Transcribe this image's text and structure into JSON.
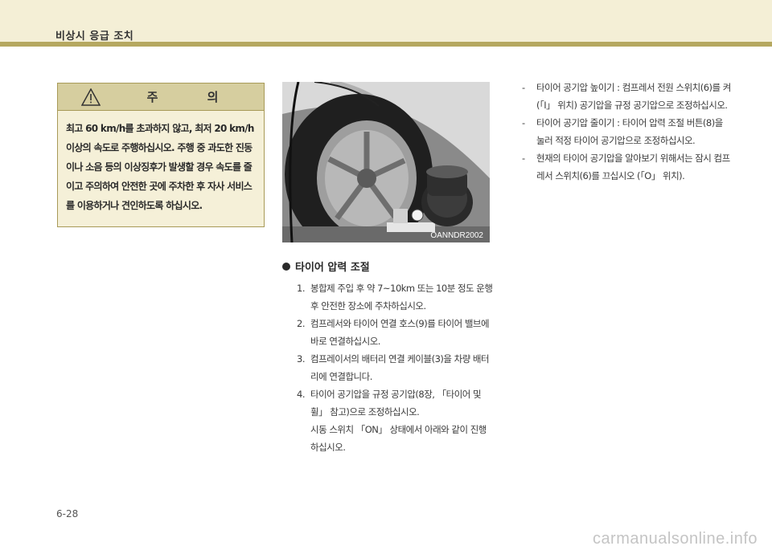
{
  "header": {
    "title": "비상시 응급 조치"
  },
  "caution": {
    "title": "주 의",
    "body": "최고 60 km/h를 초과하지 않고, 최저 20 km/h 이상의 속도로 주행하십시오. 주행 중 과도한 진동이나 소음 등의 이상징후가 발생할 경우 속도를 줄이고 주의하여 안전한 곳에 주차한 후 자사 서비스를 이용하거나 견인하도록 하십시오."
  },
  "photo": {
    "code": "OANNDR2002"
  },
  "section": {
    "title": "타이어 압력 조절",
    "steps": [
      {
        "num": "1.",
        "text": "봉합제 주입 후 약 7~10km 또는 10분 정도 운행 후 안전한 장소에 주차하십시오."
      },
      {
        "num": "2.",
        "text": "컴프레서와 타이어 연결 호스(9)를 타이어 밸브에 바로 연결하십시오."
      },
      {
        "num": "3.",
        "text": "컴프레이서의 배터리 연결 케이블(3)을 차량 배터리에 연결합니다."
      },
      {
        "num": "4.",
        "text": "타이어 공기압을 규정 공기압(8장, 「타이어 및 휠」 참고)으로 조정하십시오.",
        "extra": "시동 스위치 「ON」 상태에서 아래와 같이 진행하십시오."
      }
    ]
  },
  "right_list": [
    {
      "dash": "-",
      "text": "타이어 공기압 높이기 : 컴프레서 전원 스위치(6)를 켜(「I」 위치) 공기압을 규정 공기압으로 조정하십시오."
    },
    {
      "dash": "-",
      "text": "타이어 공기압 줄이기 : 타이어 압력 조절 버튼(8)을 눌러 적정 타이어 공기압으로 조정하십시오."
    },
    {
      "dash": "-",
      "text": "현재의 타이어 공기압을 알아보기 위해서는 잠시 컴프레서 스위치(6)를 끄십시오 (「O」 위치)."
    }
  ],
  "footer": {
    "page": "6-28",
    "watermark": "carmanualsonline.info"
  },
  "colors": {
    "band": "#f4efd6",
    "rule": "#b5a860",
    "caution_head": "#d6ce9f",
    "caution_bg": "#f5f0d8"
  }
}
